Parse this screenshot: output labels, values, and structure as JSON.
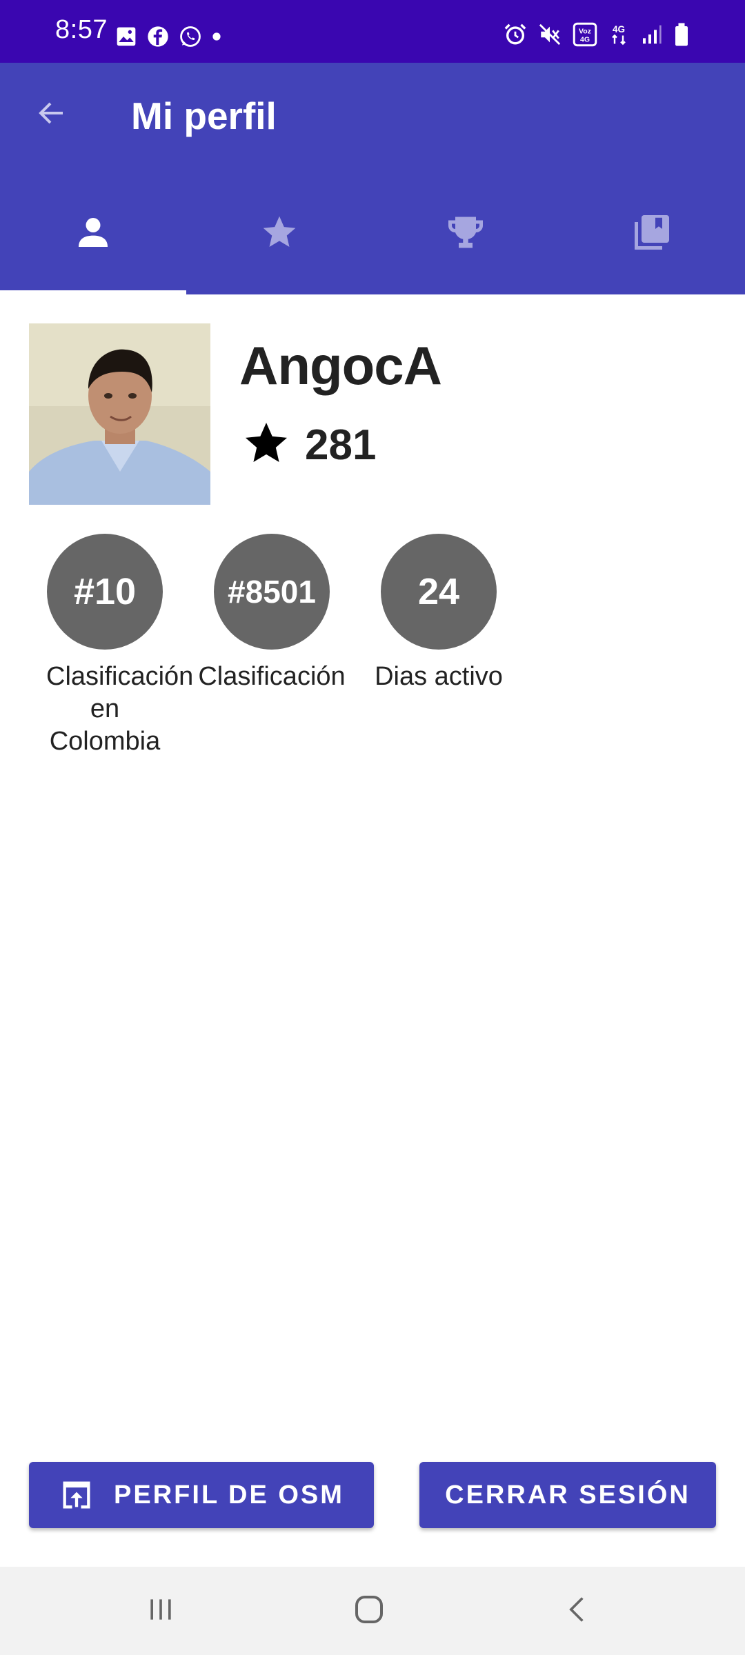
{
  "status_bar": {
    "time": "8:57",
    "left_icons": [
      "image-icon",
      "facebook-icon",
      "whatsapp-icon",
      "dot-icon"
    ],
    "right_icons": [
      "alarm-icon",
      "mute-icon",
      "volte-icon",
      "4g-icon",
      "signal-icon",
      "battery-icon"
    ],
    "volte_label": "Voz 4G",
    "network_label": "4G"
  },
  "app_bar": {
    "title": "Mi perfil",
    "back_icon": "arrow-back-icon"
  },
  "tabs": [
    {
      "icon": "person-icon",
      "selected": true
    },
    {
      "icon": "star-icon",
      "selected": false
    },
    {
      "icon": "trophy-icon",
      "selected": false
    },
    {
      "icon": "library-icon",
      "selected": false
    }
  ],
  "profile": {
    "username": "AngocA",
    "points": "281",
    "points_icon": "star-icon"
  },
  "stats": [
    {
      "value": "#10",
      "label": "Clasificación en Colombia"
    },
    {
      "value": "#8501",
      "label": "Clasificación"
    },
    {
      "value": "24",
      "label": "Dias activo"
    }
  ],
  "buttons": {
    "osm_profile": "PERFIL DE OSM",
    "logout": "CERRAR SESIÓN"
  },
  "nav_bar": {
    "icons": [
      "recents-icon",
      "home-icon",
      "back-icon"
    ]
  },
  "colors": {
    "status_bar": "#3a06b0",
    "primary": "#4343b8",
    "circle": "#666666"
  }
}
